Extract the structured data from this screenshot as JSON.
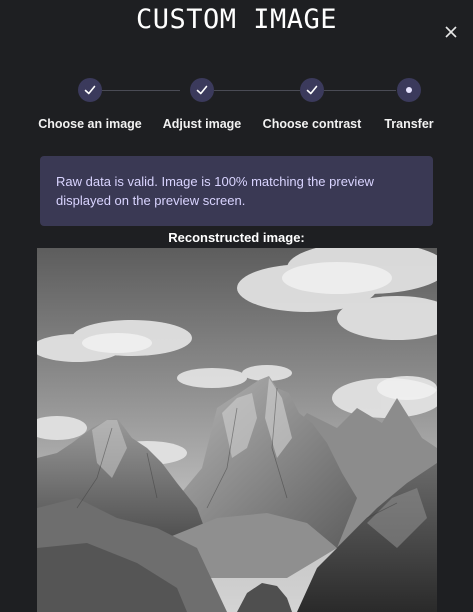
{
  "header": {
    "title": "CUSTOM IMAGE"
  },
  "stepper": {
    "steps": [
      {
        "label": "Choose an image",
        "state": "done"
      },
      {
        "label": "Adjust image",
        "state": "done"
      },
      {
        "label": "Choose contrast",
        "state": "done"
      },
      {
        "label": "Transfer",
        "state": "current"
      }
    ]
  },
  "notice": {
    "text": "Raw data is valid. Image is 100% matching the preview displayed on the preview screen."
  },
  "preview": {
    "label": "Reconstructed image:",
    "alt": "grayscale mountain landscape"
  },
  "colors": {
    "background": "#1e1f22",
    "step_circle": "#3b3a5c",
    "notice_bg": "#3a3954",
    "notice_text": "#d9d4ff"
  }
}
